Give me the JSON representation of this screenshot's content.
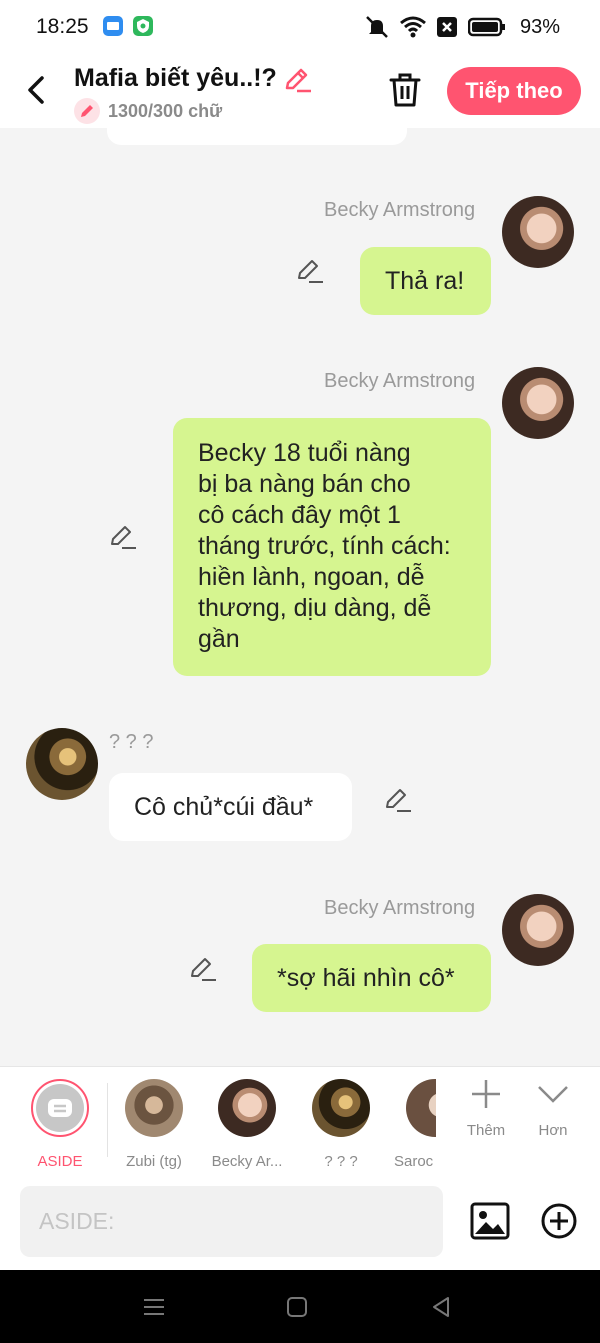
{
  "status_bar": {
    "time": "18:25",
    "battery": "93%"
  },
  "header": {
    "title": "Mafia biết yêu..!?",
    "word_count": "1300/300 chữ",
    "next_button": "Tiếp theo"
  },
  "messages": [
    {
      "sender": "Becky Armstrong",
      "side": "right",
      "text": "Thả ra!"
    },
    {
      "sender": "Becky Armstrong",
      "side": "right",
      "lines": [
        "Becky 18 tuổi nàng",
        "bị ba nàng bán cho",
        "cô cách đây một 1",
        "tháng trước, tính cách:",
        "hiền lành, ngoan, dễ",
        "thương, dịu dàng, dễ",
        "gần"
      ]
    },
    {
      "sender": "? ? ?",
      "side": "left",
      "text": "Cô chủ*cúi đầu*"
    },
    {
      "sender": "Becky Armstrong",
      "side": "right",
      "text": "*sợ hãi nhìn cô*"
    }
  ],
  "characters": [
    {
      "label": "ASIDE",
      "selected": true
    },
    {
      "label": "Zubi (tg)"
    },
    {
      "label": "Becky Ar..."
    },
    {
      "label": "? ? ?"
    },
    {
      "label": "Saroc"
    }
  ],
  "tools": {
    "add_label": "Thêm",
    "more_label": "Hơn"
  },
  "input": {
    "placeholder": "ASIDE:"
  },
  "colors": {
    "accent": "#ff5470",
    "green_bubble": "#d6f590",
    "white_bubble": "#ffffff"
  },
  "icons": [
    "back-arrow-icon",
    "pencil-icon",
    "trash-icon",
    "image-icon",
    "add-circle-icon",
    "plus-icon",
    "chevron-down-icon",
    "menu-icon",
    "home-icon",
    "back-triangle-icon"
  ]
}
